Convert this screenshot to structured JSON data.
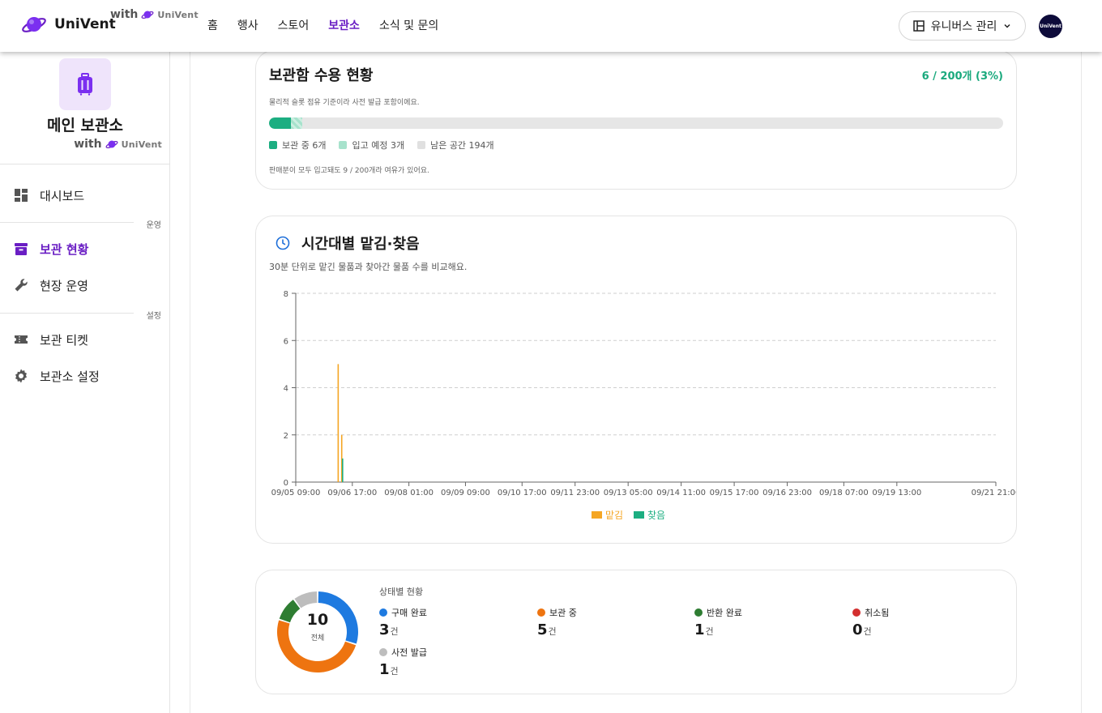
{
  "header": {
    "brand": "UniVent",
    "with_label": "with",
    "with_brand": "UniVent",
    "nav": [
      "홈",
      "행사",
      "스토어",
      "보관소",
      "소식 및 문의"
    ],
    "nav_active": "보관소",
    "universe_button": "유니버스 관리",
    "avatar_text": "UniVent"
  },
  "sidebar": {
    "store_name": "메인 보관소",
    "with_label": "with",
    "with_brand": "UniVent",
    "items": [
      {
        "label": "대시보드",
        "icon": "dashboard-icon"
      },
      {
        "label": "보관 현황",
        "icon": "archive-icon",
        "active": true
      },
      {
        "label": "현장 운영",
        "icon": "wrench-icon"
      },
      {
        "label": "보관 티켓",
        "icon": "ticket-icon"
      },
      {
        "label": "보관소 설정",
        "icon": "gear-icon"
      }
    ],
    "sections": {
      "operations": "운영",
      "settings": "설정"
    }
  },
  "capacity": {
    "title": "보관함 수용 현황",
    "ratio": "6 / 200개 (3%)",
    "note": "물리적 슬롯 점유 기준이라 사전 발급 포함이에요.",
    "stored_fraction": 0.03,
    "incoming_fraction": 0.015,
    "legend": {
      "stored": "보관 중 6개",
      "incoming": "입고 예정 3개",
      "remaining": "남은 공간 194개"
    },
    "footer": "판매분이 모두 입고돼도 9 / 200개라 여유가 있어요.",
    "colors": {
      "stored": "#1cae81",
      "incoming": "#a7e2cc",
      "remaining": "#e0e0e0"
    }
  },
  "timeline": {
    "title": "시간대별 맡김·찾음",
    "subtitle": "30분 단위로 맡긴 물품과 찾아간 물품 수를 비교해요."
  },
  "chart_data": {
    "type": "bar",
    "x_tick_labels": [
      "09/05 09:00",
      "09/06 17:00",
      "09/08 01:00",
      "09/09 09:00",
      "09/10 17:00",
      "09/11 23:00",
      "09/13 05:00",
      "09/14 11:00",
      "09/15 17:00",
      "09/16 23:00",
      "09/18 07:00",
      "09/19 13:00",
      "09/21 21:00"
    ],
    "x_tick_hours": [
      0,
      32,
      64,
      96,
      128,
      158,
      188,
      218,
      248,
      278,
      310,
      340,
      396
    ],
    "x_range_hours": [
      0,
      396
    ],
    "y_ticks": [
      0,
      2,
      4,
      6,
      8
    ],
    "ylim": [
      0,
      8
    ],
    "grid": true,
    "legend_position": "bottom-center",
    "series": [
      {
        "name": "맡김",
        "color": "#f5a623",
        "points": [
          {
            "x": 24,
            "y": 5
          },
          {
            "x": 26,
            "y": 2
          }
        ]
      },
      {
        "name": "찾음",
        "color": "#1cae81",
        "points": [
          {
            "x": 26.5,
            "y": 1
          }
        ]
      }
    ]
  },
  "status": {
    "label": "상태별 현황",
    "total": "10",
    "total_label": "전체",
    "unit": "건",
    "items": [
      {
        "name": "구매 완료",
        "count": "3",
        "color": "#1e7ae0"
      },
      {
        "name": "보관 중",
        "count": "5",
        "color": "#ee7410"
      },
      {
        "name": "반환 완료",
        "count": "1",
        "color": "#2e7d32"
      },
      {
        "name": "취소됨",
        "count": "0",
        "color": "#d32f2f"
      },
      {
        "name": "사전 발급",
        "count": "1",
        "color": "#bdbdbd"
      }
    ]
  }
}
